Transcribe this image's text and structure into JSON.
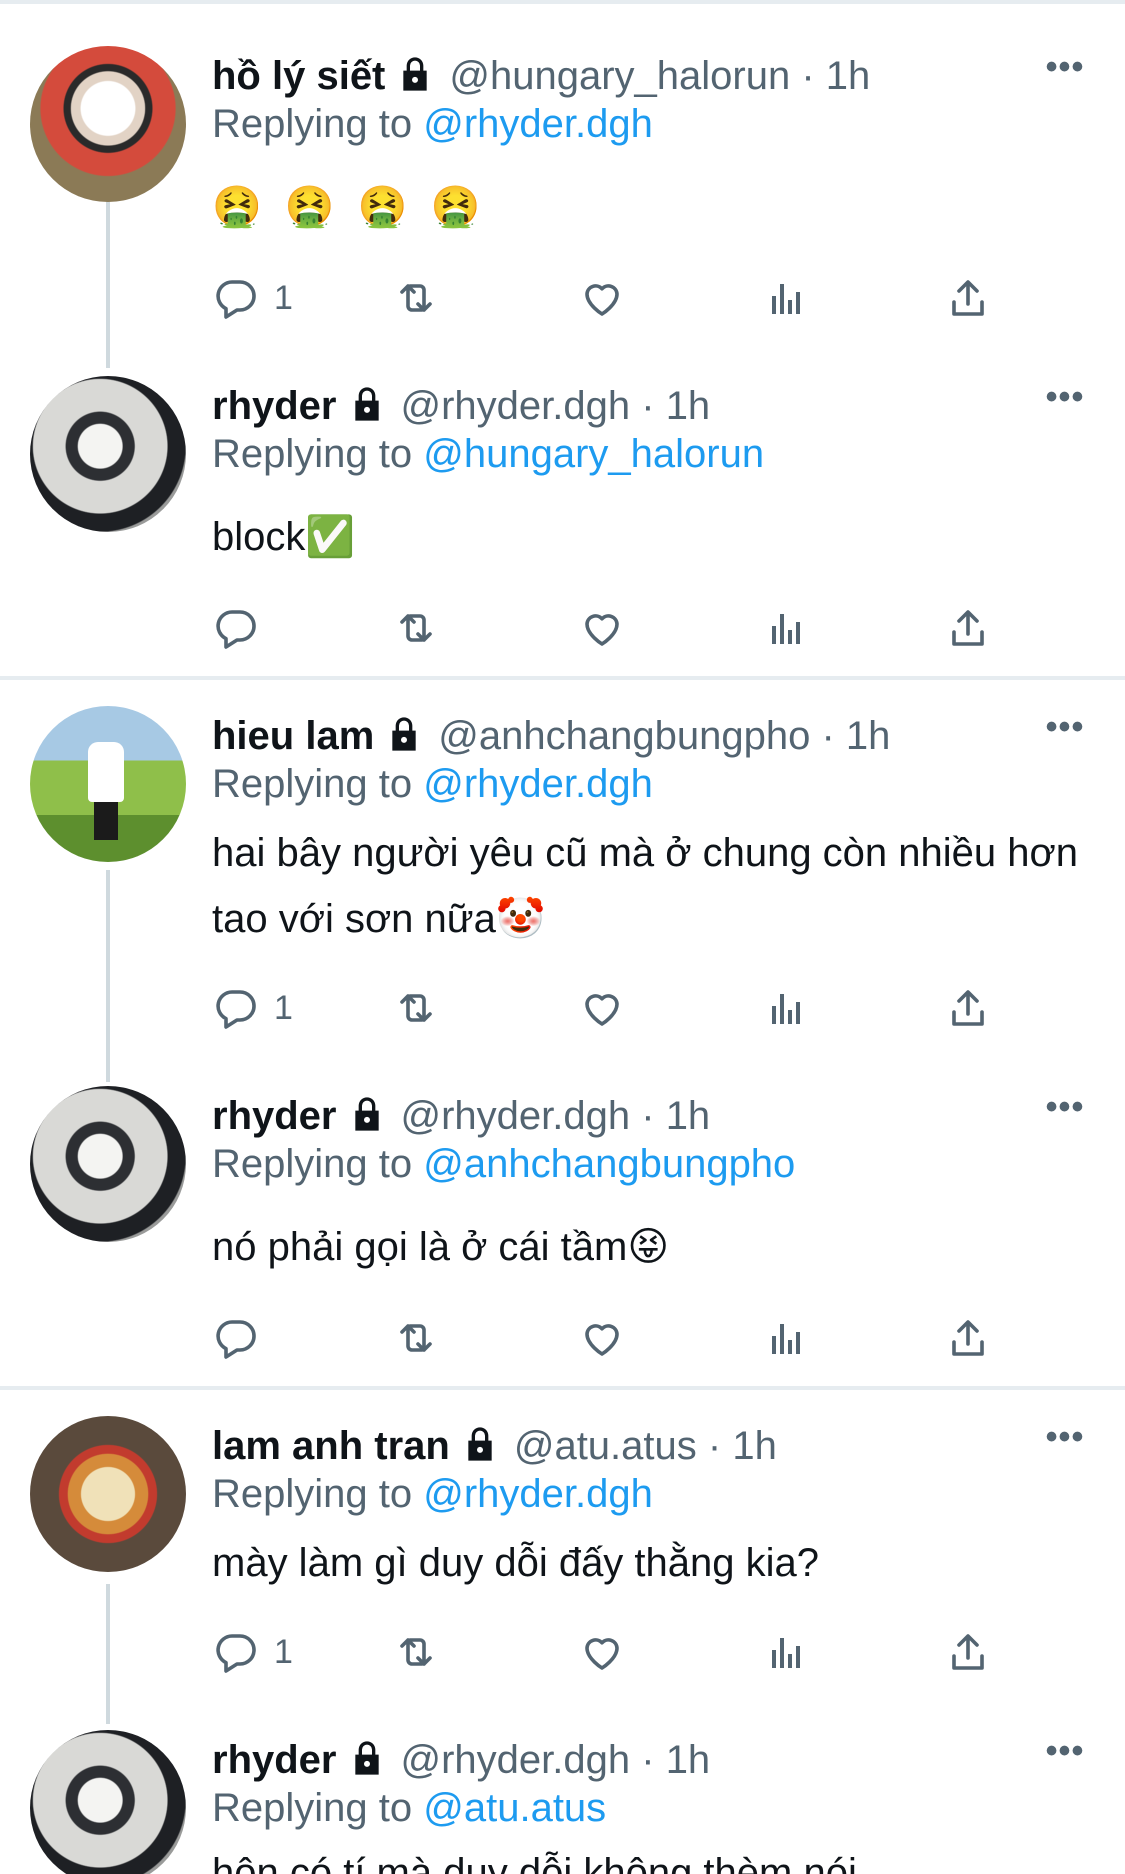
{
  "tweets": [
    {
      "name": "hồ lý siết",
      "handle": "@hungary_halorun",
      "time": "1h",
      "replying_label": "Replying to",
      "replying_to": "@rhyder.dgh",
      "text": "🤮 🤮 🤮 🤮",
      "reply_count": "1"
    },
    {
      "name": "rhyder",
      "handle": "@rhyder.dgh",
      "time": "1h",
      "replying_label": "Replying to",
      "replying_to": "@hungary_halorun",
      "text": "block✅",
      "reply_count": ""
    },
    {
      "name": "hieu lam",
      "handle": "@anhchangbungpho",
      "time": "1h",
      "replying_label": "Replying to",
      "replying_to": "@rhyder.dgh",
      "text": "hai bây người yêu cũ mà ở chung còn nhiều hơn tao với sơn nữa🤡",
      "reply_count": "1"
    },
    {
      "name": "rhyder",
      "handle": "@rhyder.dgh",
      "time": "1h",
      "replying_label": "Replying to",
      "replying_to": "@anhchangbungpho",
      "text": "nó phải gọi là ở cái tầm😝",
      "reply_count": ""
    },
    {
      "name": "lam anh tran",
      "handle": "@atu.atus",
      "time": "1h",
      "replying_label": "Replying to",
      "replying_to": "@rhyder.dgh",
      "text": "mày làm gì duy dỗi đấy thằng kia?",
      "reply_count": "1"
    },
    {
      "name": "rhyder",
      "handle": "@rhyder.dgh",
      "time": "1h",
      "replying_label": "Replying to",
      "replying_to": "@atu.atus",
      "text": "hôn có tí mà duy dỗi không thèm nói",
      "reply_count": ""
    }
  ],
  "ui": {
    "more_glyph": "•••",
    "separator": " · ",
    "accent": "#1d9bf0",
    "muted": "#536471",
    "icons": [
      "reply-icon",
      "retweet-icon",
      "like-icon",
      "views-icon",
      "share-icon",
      "lock-icon",
      "more-icon"
    ]
  }
}
